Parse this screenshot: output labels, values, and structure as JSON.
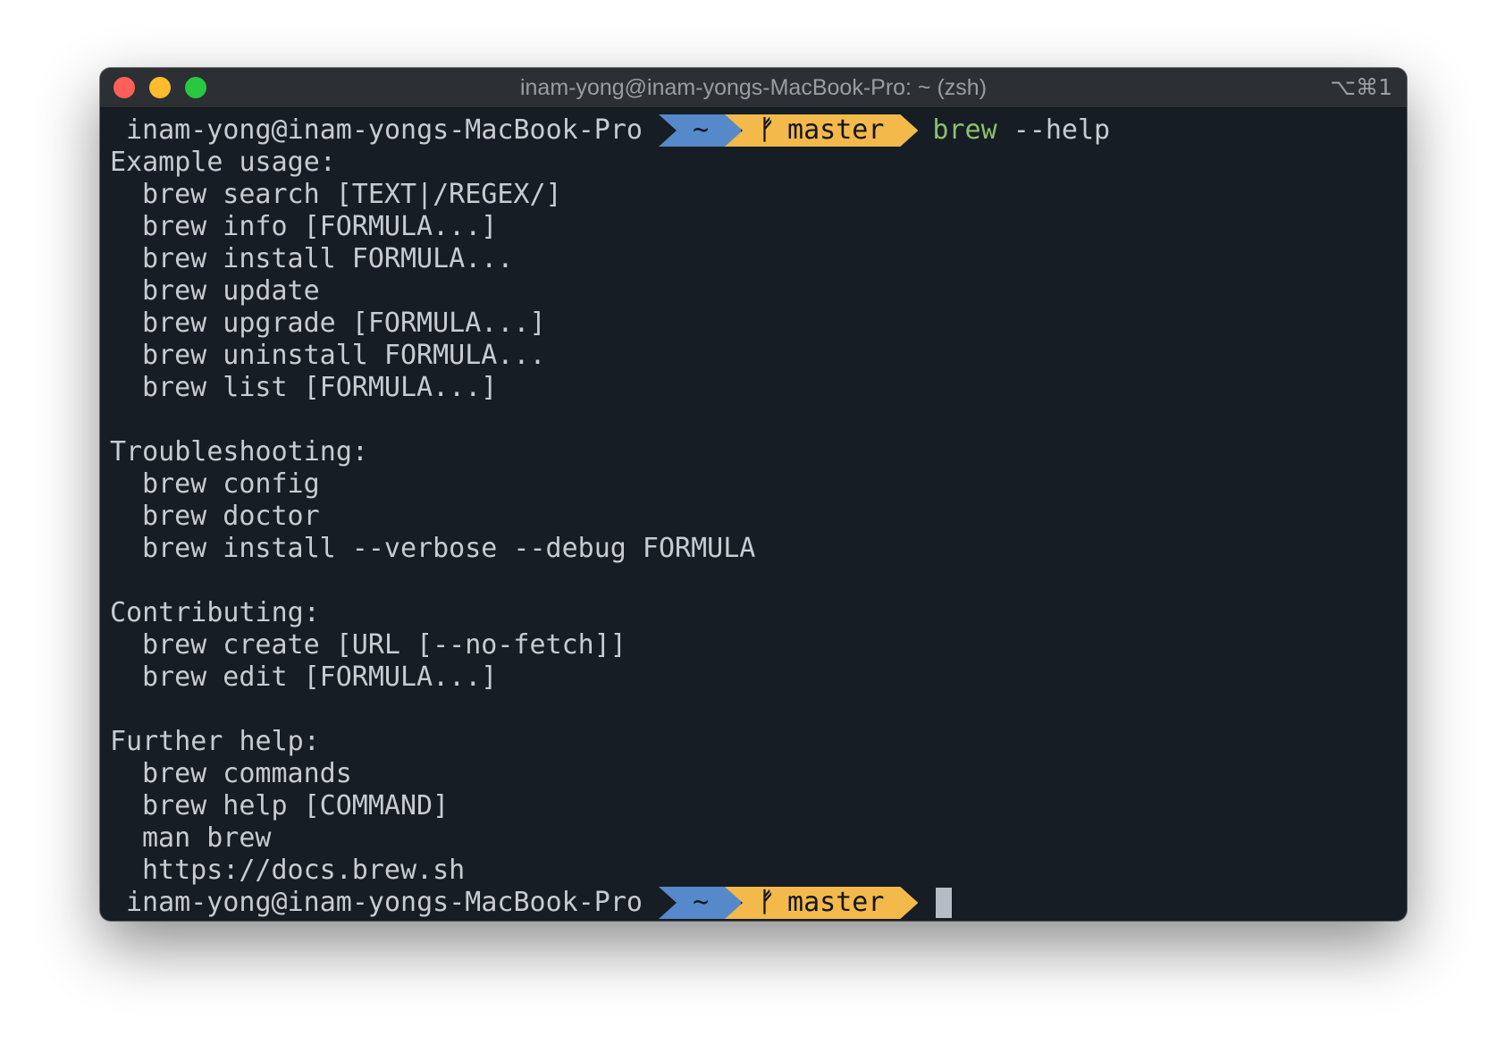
{
  "window": {
    "title": "inam-yong@inam-yongs-MacBook-Pro: ~ (zsh)",
    "shortcut": "⌥⌘1",
    "colors": {
      "background": "#161d25",
      "titlebar": "#2c2f33",
      "dir_segment": "#5689c9",
      "git_segment": "#f3b94b",
      "command": "#8fbf6b"
    }
  },
  "prompt": {
    "user_host": "inam-yong@inam-yongs-MacBook-Pro",
    "dir": "~",
    "branch_icon": "git-branch-icon",
    "branch": "master"
  },
  "command": {
    "bin": "brew",
    "args": "--help"
  },
  "output": {
    "example_heading": "Example usage:",
    "example_lines": [
      "brew search [TEXT|/REGEX/]",
      "brew info [FORMULA...]",
      "brew install FORMULA...",
      "brew update",
      "brew upgrade [FORMULA...]",
      "brew uninstall FORMULA...",
      "brew list [FORMULA...]"
    ],
    "troubleshooting_heading": "Troubleshooting:",
    "troubleshooting_lines": [
      "brew config",
      "brew doctor",
      "brew install --verbose --debug FORMULA"
    ],
    "contributing_heading": "Contributing:",
    "contributing_lines": [
      "brew create [URL [--no-fetch]]",
      "brew edit [FORMULA...]"
    ],
    "further_heading": "Further help:",
    "further_lines": [
      "brew commands",
      "brew help [COMMAND]",
      "man brew",
      "https://docs.brew.sh"
    ]
  }
}
